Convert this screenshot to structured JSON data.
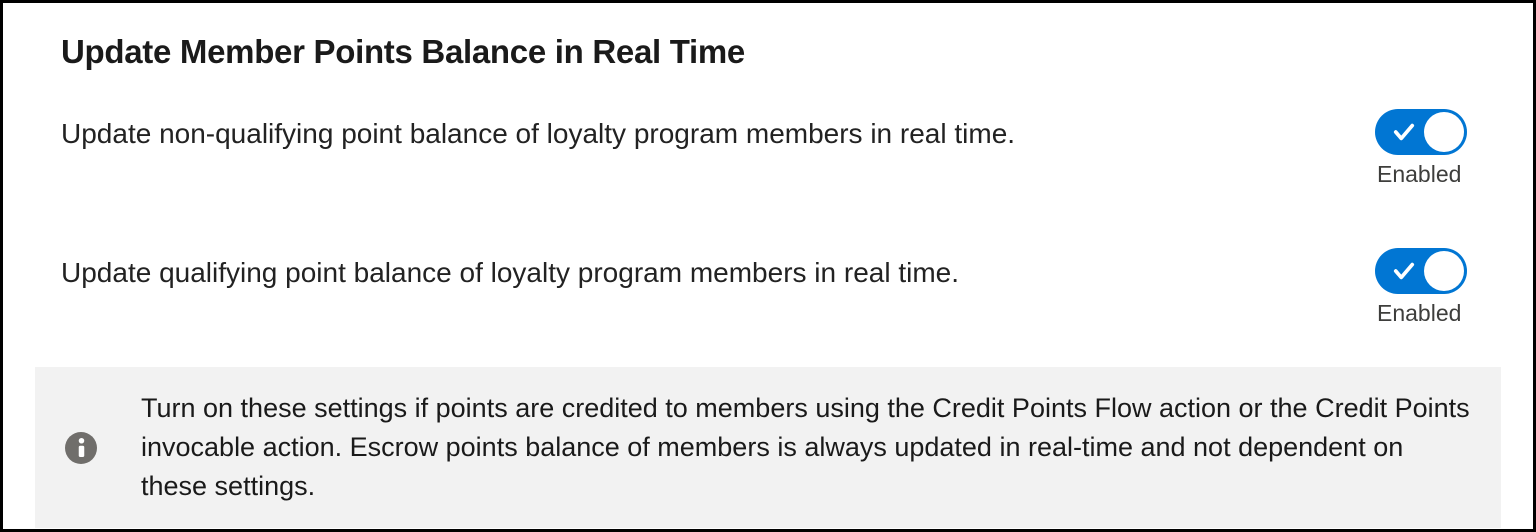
{
  "section": {
    "title": "Update Member Points Balance in Real Time"
  },
  "settings": [
    {
      "label": "Update non-qualifying point balance of loyalty program members in real time.",
      "status": "Enabled",
      "on": true
    },
    {
      "label": "Update qualifying point balance of loyalty program members in real time.",
      "status": "Enabled",
      "on": true
    }
  ],
  "info": {
    "text": "Turn on these settings if points are credited to members using the Credit Points Flow action or the Credit Points invocable action. Escrow points balance of members is always updated in real-time and not dependent on these settings."
  },
  "colors": {
    "toggleOn": "#0176d3",
    "infoBg": "#f2f2f2",
    "infoIconBg": "#706e6b"
  }
}
